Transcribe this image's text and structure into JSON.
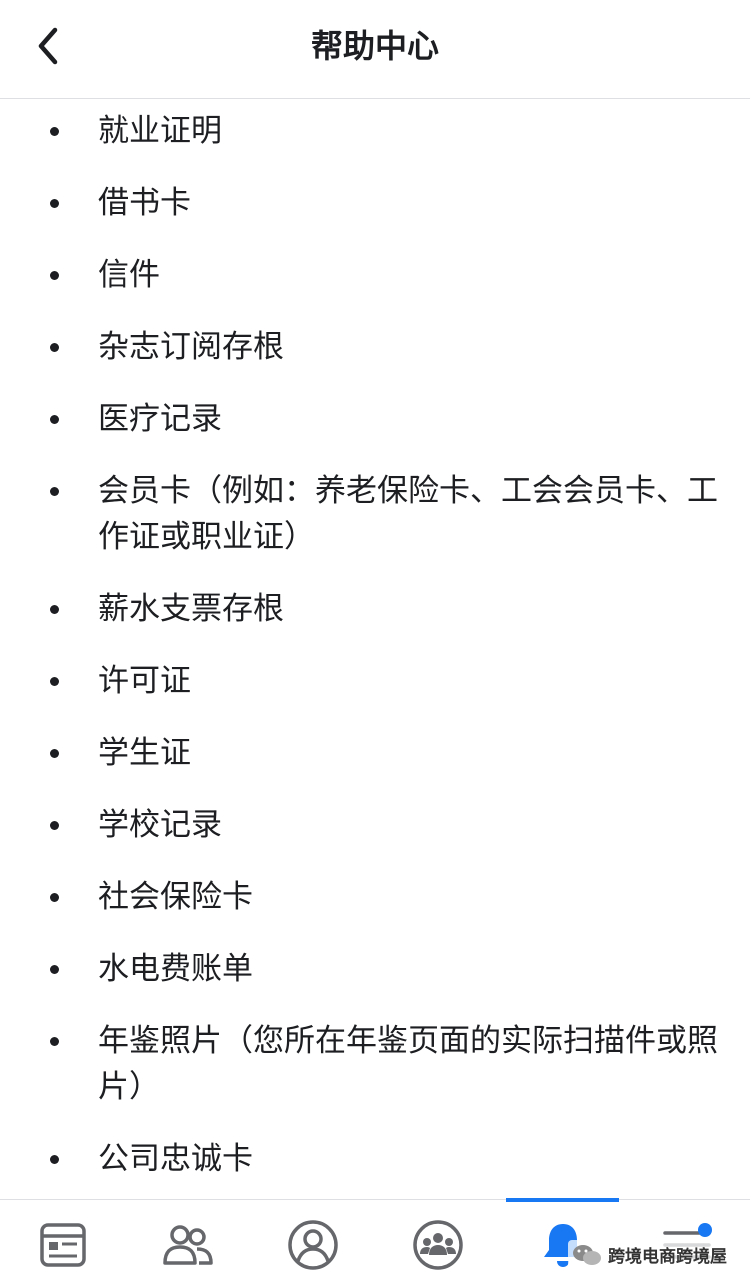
{
  "header": {
    "title": "帮助中心",
    "back_icon": "chevron-left-icon"
  },
  "list": {
    "items": [
      "就业证明",
      "借书卡",
      "信件",
      "杂志订阅存根",
      "医疗记录",
      "会员卡（例如：养老保险卡、工会会员卡、工作证或职业证）",
      "薪水支票存根",
      "许可证",
      "学生证",
      "学校记录",
      "社会保险卡",
      "水电费账单",
      "年鉴照片（您所在年鉴页面的实际扫描件或照片）",
      "公司忠诚卡"
    ]
  },
  "tabbar": {
    "tabs": [
      {
        "icon": "news-feed-icon"
      },
      {
        "icon": "friends-icon"
      },
      {
        "icon": "profile-icon"
      },
      {
        "icon": "groups-icon"
      },
      {
        "icon": "notifications-bell-icon",
        "active": true
      },
      {
        "icon": "menu-icon"
      }
    ],
    "active_color": "#1877f2",
    "icon_color": "#65676b"
  },
  "watermark": {
    "text": "跨境电商跨境屋"
  }
}
